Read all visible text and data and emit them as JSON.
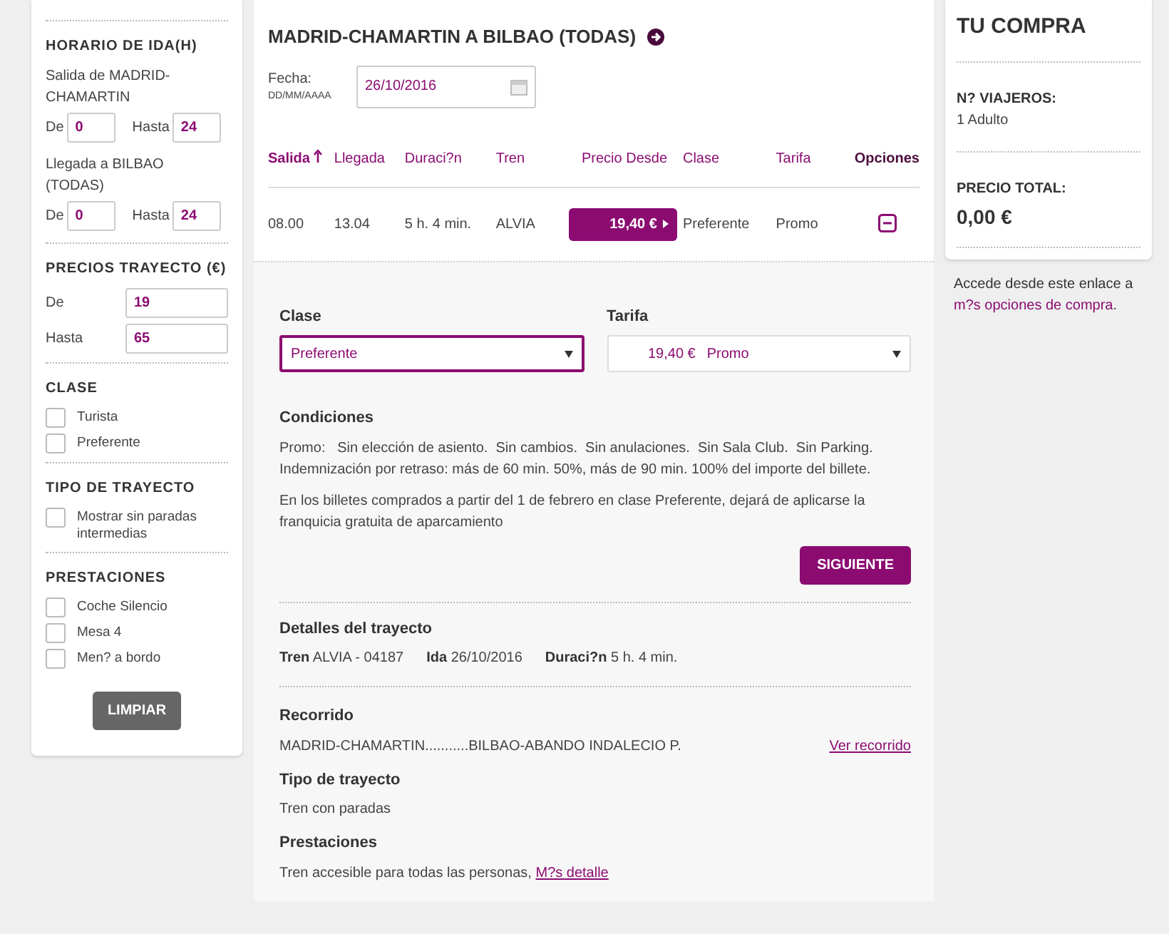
{
  "sidebar": {
    "schedule": {
      "title": "HORARIO DE IDA(H)",
      "groups": [
        {
          "label": "Salida de MADRID-CHAMARTIN",
          "from_label": "De",
          "from_value": "0",
          "to_label": "Hasta",
          "to_value": "24"
        },
        {
          "label": "Llegada a BILBAO (TODAS)",
          "from_label": "De",
          "from_value": "0",
          "to_label": "Hasta",
          "to_value": "24"
        }
      ]
    },
    "prices": {
      "title": "PRECIOS TRAYECTO (€)",
      "rows": [
        {
          "label": "De",
          "value": "19"
        },
        {
          "label": "Hasta",
          "value": "65"
        }
      ]
    },
    "filters": [
      {
        "title": "CLASE",
        "options": [
          {
            "label": "Turista",
            "checked": false
          },
          {
            "label": "Preferente",
            "checked": false
          }
        ]
      },
      {
        "title": "TIPO DE TRAYECTO",
        "options": [
          {
            "label": "Mostrar sin paradas intermedias",
            "checked": false
          }
        ]
      },
      {
        "title": "PRESTACIONES",
        "options": [
          {
            "label": "Coche Silencio",
            "checked": false
          },
          {
            "label": "Mesa 4",
            "checked": false
          },
          {
            "label": "Men? a bordo",
            "checked": false
          }
        ]
      }
    ],
    "clear_button": "LIMPIAR"
  },
  "main": {
    "title": "MADRID-CHAMARTIN A BILBAO (TODAS)",
    "date": {
      "label": "Fecha:",
      "hint": "DD/MM/AAAA",
      "value": "26/10/2016"
    },
    "table": {
      "columns": [
        {
          "label": "Salida",
          "sorted": true
        },
        {
          "label": "Llegada",
          "sorted": false
        },
        {
          "label": "Duraci?n",
          "sorted": false
        },
        {
          "label": "Tren",
          "sorted": false
        },
        {
          "label": "Precio Desde",
          "sorted": false
        },
        {
          "label": "Clase",
          "sorted": false
        },
        {
          "label": "Tarifa",
          "sorted": false
        },
        {
          "label": "Opciones",
          "sorted": false
        }
      ],
      "rows": [
        {
          "departure": "08.00",
          "arrival": "13.04",
          "duration": "5 h. 4 min.",
          "train": "ALVIA",
          "price": "19,40 €",
          "class": "Preferente",
          "fare": "Promo",
          "expanded": true
        }
      ]
    },
    "options": {
      "class_select": {
        "label": "Clase",
        "value": "Preferente",
        "focused": true
      },
      "fare_select": {
        "label": "Tarifa",
        "price": "19,40 €",
        "value": "Promo",
        "focused": false
      },
      "conditions": {
        "title": "Condiciones",
        "paragraphs": [
          "Promo:   Sin elección de asiento.  Sin cambios.  Sin anulaciones.  Sin Sala Club.  Sin Parking.  Indemnización por retraso: más de 60 min. 50%, más de 90 min. 100% del importe del billete.",
          "En los billetes comprados a partir del 1 de febrero en clase Preferente, dejará de aplicarse la franquicia gratuita de aparcamiento"
        ]
      },
      "next_button": "SIGUIENTE"
    },
    "trip_details": {
      "title": "Detalles del trayecto",
      "items": [
        {
          "label": "Tren",
          "value": "ALVIA - 04187"
        },
        {
          "label": "Ida",
          "value": "26/10/2016"
        },
        {
          "label": "Duraci?n",
          "value": "5 h. 4 min."
        }
      ]
    },
    "route": {
      "title": "Recorrido",
      "text": "MADRID-CHAMARTIN...........BILBAO-ABANDO INDALECIO P.",
      "link": "Ver recorrido"
    },
    "trip_type": {
      "title": "Tipo de trayecto",
      "text": "Tren con paradas"
    },
    "amenities": {
      "title": "Prestaciones",
      "text": "Tren accesible para todas las personas,",
      "link": "M?s detalle"
    }
  },
  "purchase": {
    "title": "TU COMPRA",
    "travellers": {
      "label": "N? VIAJEROS:",
      "value": "1 Adulto"
    },
    "total": {
      "label": "PRECIO TOTAL:",
      "value": "0,00 €"
    },
    "note": {
      "text": "Accede desde este enlace a",
      "link": "m?s opciones de compra",
      "end": "."
    }
  }
}
